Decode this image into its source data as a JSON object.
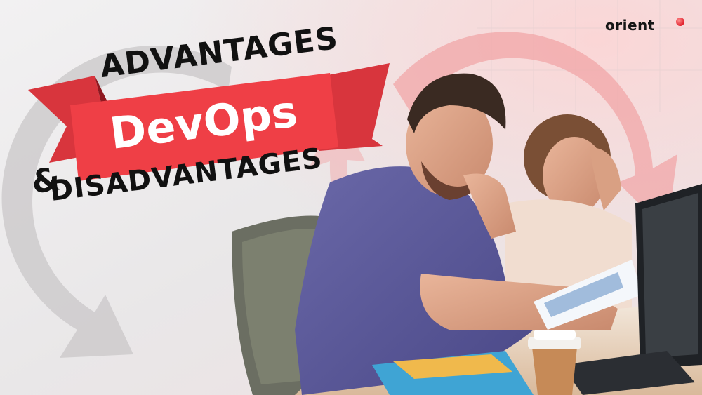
{
  "brand": {
    "logo_text": "orient",
    "dot_color": "#e32630"
  },
  "headline": {
    "line1": "ADVANTAGES",
    "ampersand": "&",
    "line2": "DISADVANTAGES",
    "banner_text": "DevOps"
  },
  "colors": {
    "banner_red": "#ee3e45",
    "banner_dark_red": "#b6212a",
    "arrow_gray": "#c9c7c8",
    "arrow_pink": "#f3a7a9",
    "background": "#ecebec"
  },
  "icons": [
    "cycle-arrow-gray-icon",
    "cycle-arrow-pink-icon",
    "logo-dot-icon"
  ]
}
